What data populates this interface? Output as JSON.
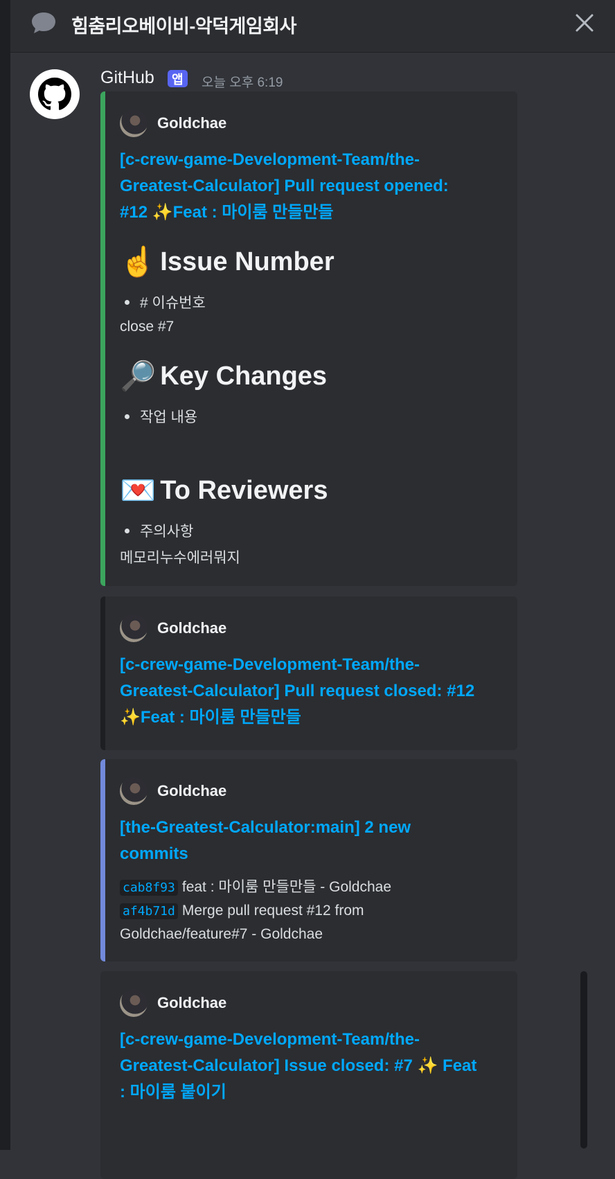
{
  "header": {
    "channel_title": "힘춤리오베이비-악덕게임회사",
    "thread_icon": "thread-bubble-icon",
    "close_icon": "close-icon"
  },
  "message": {
    "author": "GitHub",
    "app_badge": "앱",
    "timestamp": "오늘 오후 6:19",
    "avatar_icon": "github-logo-icon"
  },
  "embeds": [
    {
      "accent": "#3ba55d",
      "author": "Goldchae",
      "title_lines": [
        "[c-crew-game-Development-Team/the-",
        "Greatest-Calculator] Pull request opened:",
        "#12 ✨Feat : 마이룸 만들만들"
      ],
      "sections": [
        {
          "emoji": "☝️",
          "heading": "Issue Number",
          "bullet": "# 이슈번호",
          "text": "close #7"
        },
        {
          "emoji": "🔎",
          "heading": "Key Changes",
          "bullet": "작업 내용",
          "text": ""
        },
        {
          "emoji": "💌",
          "heading": "To Reviewers",
          "bullet": "주의사항",
          "text": "메모리누수에러뭐지"
        }
      ]
    },
    {
      "accent": "#1e1f22",
      "author": "Goldchae",
      "title_lines": [
        "[c-crew-game-Development-Team/the-",
        "Greatest-Calculator] Pull request closed: #12",
        "✨Feat : 마이룸 만들만들"
      ]
    },
    {
      "accent": "#7289da",
      "author": "Goldchae",
      "title_lines": [
        "[the-Greatest-Calculator:main] 2 new",
        "commits"
      ],
      "commits": [
        {
          "hash": "cab8f93",
          "message": "feat : 마이룸 만들만들 - Goldchae"
        },
        {
          "hash": "af4b71d",
          "message": "Merge pull request #12 from",
          "message_cont": "Goldchae/feature#7 - Goldchae"
        }
      ]
    },
    {
      "accent": "#2b2d31",
      "author": "Goldchae",
      "title_lines": [
        "[c-crew-game-Development-Team/the-",
        "Greatest-Calculator] Issue closed: #7 ✨ Feat",
        ": 마이룸 붙이기"
      ]
    }
  ]
}
